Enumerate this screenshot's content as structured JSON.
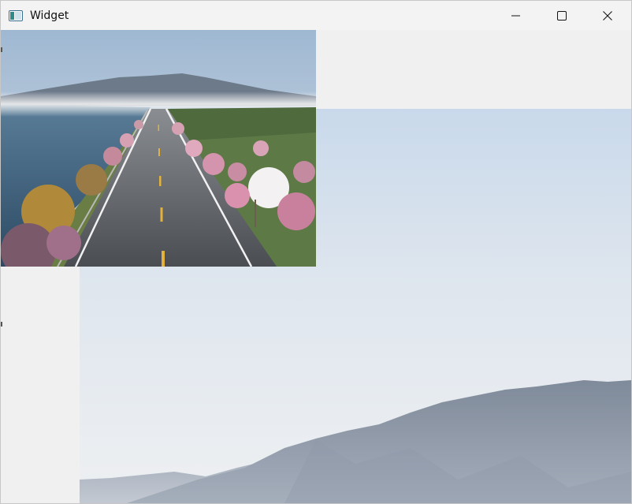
{
  "window": {
    "title": "Widget",
    "controls": {
      "minimize_icon": "minimize-icon",
      "maximize_icon": "maximize-icon",
      "close_icon": "close-icon"
    }
  },
  "content": {
    "background_image": {
      "icon": "landscape-mountains-image",
      "description": ""
    },
    "foreground_image": {
      "icon": "coastal-road-image"
    }
  },
  "colors": {
    "titlebar": "#f3f3f3",
    "client_bg": "#f0f0f0",
    "sky_top": "#c8d8ea",
    "mountain": "#8994a4"
  }
}
